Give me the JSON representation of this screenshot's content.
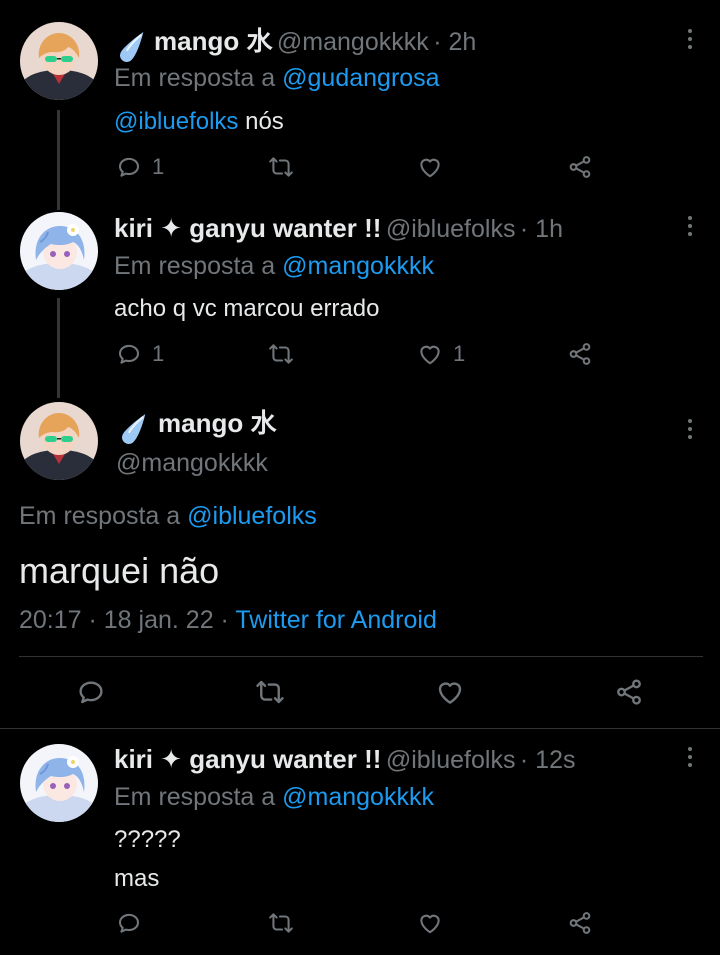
{
  "tweets": [
    {
      "display_name": "mango 水",
      "handle": "@mangokkkk",
      "time": "· 2h",
      "reply_prefix": "Em resposta a",
      "reply_to": "@gudangrosa",
      "body_mention": "@ibluefolks",
      "body_text": " nós",
      "reply_count": "1",
      "like_count": ""
    },
    {
      "display_name": "kiri ✦ ganyu wanter !!",
      "handle": "@ibluefolks",
      "time": "· 1h",
      "reply_prefix": "Em resposta a",
      "reply_to": "@mangokkkk",
      "body_text": "acho q vc marcou errado",
      "reply_count": "1",
      "like_count": "1"
    },
    {
      "display_name": "mango 水",
      "handle": "@mangokkkk",
      "reply_prefix": "Em resposta a",
      "reply_to": "@ibluefolks",
      "body_text": "marquei não",
      "timestamp": "20:17 · 18 jan. 22 ·",
      "source": "Twitter for Android"
    },
    {
      "display_name": "kiri ✦ ganyu wanter !!",
      "handle": "@ibluefolks",
      "time": "· 12s",
      "reply_prefix": "Em resposta a",
      "reply_to": "@mangokkkk",
      "body_line1": "?????",
      "body_line2": "mas"
    }
  ],
  "colors": {
    "background": "#000000",
    "text": "#e7e9ea",
    "secondary": "#71767b",
    "link": "#1d9bf0",
    "divider": "#2f3336"
  },
  "icons": [
    "droplet-icon",
    "more-icon",
    "reply-icon",
    "retweet-icon",
    "like-icon",
    "share-icon"
  ]
}
